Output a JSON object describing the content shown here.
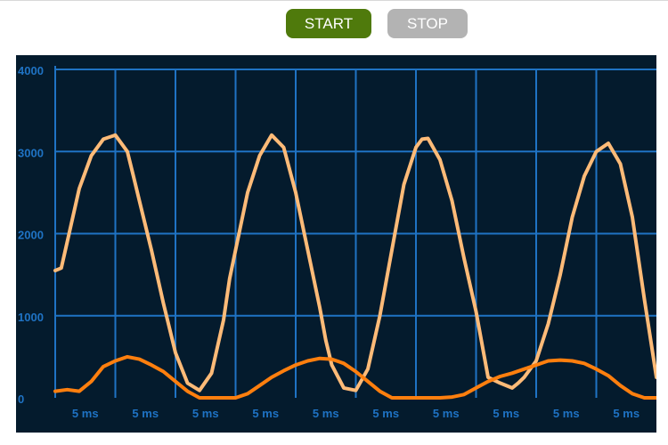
{
  "toolbar": {
    "start_label": "START",
    "stop_label": "STOP"
  },
  "colors": {
    "start_button": "#4f7a0c",
    "stop_button": "#b3b3b3",
    "plot_background": "#041b2d",
    "grid": "#1f73c4",
    "tick_label": "#1f73c4",
    "series_1": "#ffbb78",
    "series_2": "#ff7f0e"
  },
  "chart_data": {
    "type": "line",
    "ylim": [
      0,
      4000
    ],
    "y_ticks": [
      "0",
      "1000",
      "2000",
      "3000",
      "4000"
    ],
    "x_ticks": [
      "5 ms",
      "5 ms",
      "5 ms",
      "5 ms",
      "5 ms",
      "5 ms",
      "5 ms",
      "5 ms",
      "5 ms",
      "5 ms"
    ],
    "xlim": [
      0,
      100
    ],
    "grid": true,
    "series": [
      {
        "color": "#ffbb78",
        "x": [
          0,
          1,
          2,
          4,
          6,
          8,
          10,
          12,
          13,
          14,
          16,
          18,
          20,
          22,
          24,
          26,
          28,
          29,
          30,
          32,
          34,
          36,
          38,
          40,
          42,
          44,
          45,
          46,
          48,
          50,
          52,
          54,
          56,
          58,
          60,
          61,
          62,
          64,
          66,
          68,
          70,
          72,
          74,
          76,
          77,
          78,
          80,
          82,
          84,
          86,
          88,
          90,
          92,
          94,
          96,
          98,
          100
        ],
        "y": [
          1550,
          1580,
          1900,
          2550,
          2950,
          3150,
          3200,
          3000,
          2700,
          2400,
          1800,
          1150,
          550,
          180,
          90,
          300,
          950,
          1450,
          1800,
          2500,
          2950,
          3200,
          3050,
          2500,
          1800,
          1100,
          700,
          400,
          120,
          90,
          350,
          1000,
          1800,
          2600,
          3050,
          3150,
          3160,
          2900,
          2400,
          1700,
          1050,
          250,
          180,
          120,
          180,
          250,
          450,
          900,
          1500,
          2200,
          2700,
          3000,
          3100,
          2850,
          2200,
          1200,
          250
        ]
      },
      {
        "color": "#ff7f0e",
        "x": [
          0,
          2,
          4,
          6,
          8,
          10,
          12,
          14,
          16,
          18,
          20,
          22,
          24,
          26,
          28,
          30,
          32,
          34,
          36,
          38,
          40,
          42,
          44,
          46,
          48,
          50,
          52,
          54,
          56,
          58,
          60,
          62,
          64,
          66,
          68,
          70,
          72,
          74,
          76,
          78,
          80,
          82,
          84,
          86,
          88,
          90,
          92,
          94,
          96,
          98,
          100
        ],
        "y": [
          80,
          100,
          80,
          200,
          380,
          450,
          500,
          470,
          400,
          320,
          200,
          80,
          0,
          0,
          0,
          0,
          50,
          150,
          250,
          330,
          400,
          450,
          480,
          470,
          420,
          320,
          200,
          80,
          0,
          0,
          0,
          0,
          0,
          10,
          40,
          120,
          200,
          260,
          300,
          350,
          400,
          450,
          460,
          450,
          420,
          350,
          270,
          150,
          50,
          0,
          0
        ]
      }
    ]
  }
}
